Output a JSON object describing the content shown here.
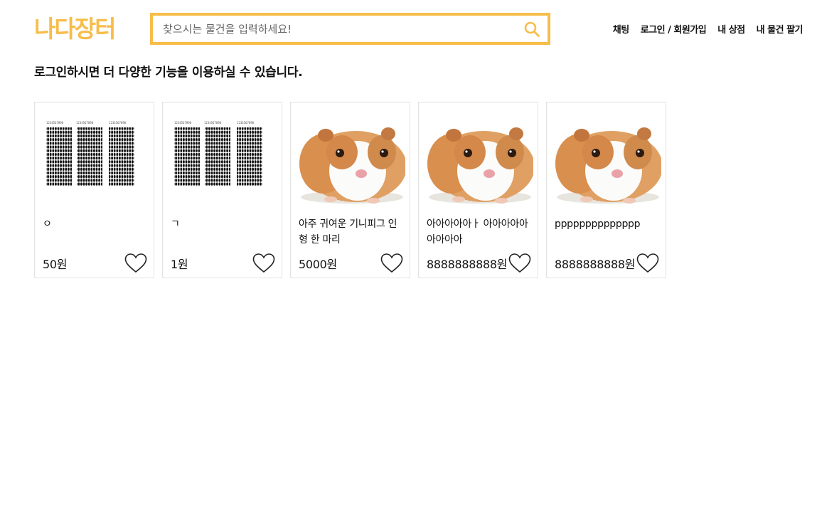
{
  "header": {
    "logo_text": "나다장터",
    "search": {
      "placeholder": "찾으시는 물건을 입력하세요!",
      "value": ""
    },
    "nav": [
      {
        "label": "채팅"
      },
      {
        "label": "로그인 / 회원가입"
      },
      {
        "label": "내 상점"
      },
      {
        "label": "내 물건 팔기"
      }
    ]
  },
  "notice": "로그인하시면 더 다양한 기능을 이용하실 수 있습니다.",
  "products": [
    {
      "title": "ㅇ",
      "price": "50원",
      "image": "answer-sheet-image"
    },
    {
      "title": "ㄱ",
      "price": "1원",
      "image": "answer-sheet-image"
    },
    {
      "title": "아주 귀여운 기니피그 인형 한 마리",
      "price": "5000원",
      "image": "guinea-pig-image"
    },
    {
      "title": "아아아아아ㅏ 아아아아아 아아아아",
      "price": "8888888888원",
      "image": "guinea-pig-image"
    },
    {
      "title": "pppppppppppppp",
      "price": "8888888888원",
      "image": "guinea-pig-image"
    }
  ],
  "colors": {
    "accent": "#f7bd4a",
    "text": "#111111",
    "border": "#e2e2e2"
  }
}
